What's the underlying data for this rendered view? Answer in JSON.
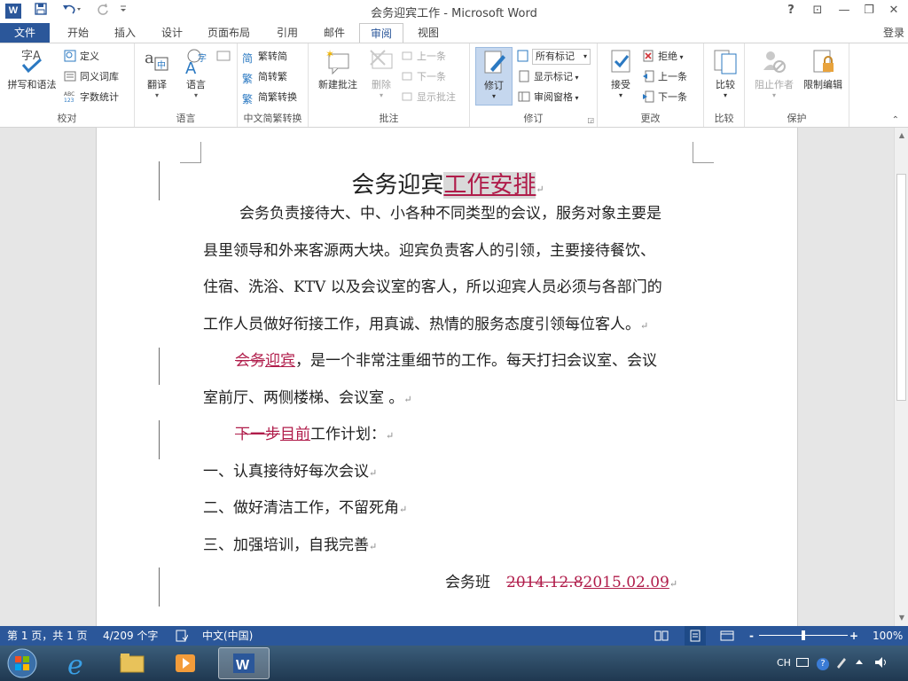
{
  "window": {
    "title": "会务迎宾工作 - Microsoft Word",
    "help": "?",
    "buttons": {
      "ribbon": "⊡",
      "minimize": "—",
      "restore": "❐",
      "close": "✕"
    }
  },
  "quick_access": {
    "logo": "W",
    "save_icon": "save-icon",
    "undo_icon": "undo-icon",
    "redo_icon": "redo-icon"
  },
  "tabs": [
    {
      "label": "文件"
    },
    {
      "label": "开始"
    },
    {
      "label": "插入"
    },
    {
      "label": "设计"
    },
    {
      "label": "页面布局"
    },
    {
      "label": "引用"
    },
    {
      "label": "邮件"
    },
    {
      "label": "审阅"
    },
    {
      "label": "视图"
    }
  ],
  "login": "登录",
  "ribbon": {
    "proofing": {
      "label": "校对",
      "spell": "拼写和语法",
      "define": "定义",
      "thesaurus": "同义词库",
      "wordcount": "字数统计"
    },
    "language": {
      "label": "语言",
      "translate": "翻译",
      "language": "语言"
    },
    "chinese": {
      "label": "中文简繁转换",
      "to_simplified": "繁转简",
      "to_traditional": "简转繁",
      "convert": "简繁转换"
    },
    "comments": {
      "label": "批注",
      "new": "新建批注",
      "delete": "删除",
      "prev": "上一条",
      "next": "下一条",
      "show": "显示批注"
    },
    "tracking": {
      "label": "修订",
      "track": "修订",
      "markup_select": "所有标记",
      "show_markup": "显示标记",
      "pane": "审阅窗格"
    },
    "changes": {
      "label": "更改",
      "accept": "接受",
      "reject": "拒绝",
      "prev": "上一条",
      "next": "下一条"
    },
    "compare": {
      "label": "比较",
      "compare": "比较"
    },
    "protect": {
      "label": "保护",
      "block": "阻止作者",
      "restrict": "限制编辑"
    }
  },
  "document": {
    "title_plain": "会务迎宾",
    "title_ins": "工作安排",
    "p1_lines": [
      "会务负责接待大、中、小各种不同类型的会议，服务对象主要是",
      "县里领导和外来客源两大块。迎宾负责客人的引领，主要接待餐饮、",
      "住宿、洗浴、KTV 以及会议室的客人，所以迎宾人员必须与各部门的",
      "工作人员做好衔接工作，用真诚、热情的服务态度引领每位客人。"
    ],
    "p2_del": "会务",
    "p2_ins": "迎宾",
    "p2_rest": "，是一个非常注重细节的工作。每天打扫会议室、会议",
    "p2_line2": "室前厅、两侧楼梯、会议室 。",
    "p3_del": "下一步",
    "p3_ins": "目前",
    "p3_rest": "工作计划：",
    "item1": "一、认真接待好每次会议",
    "item2": "二、做好清洁工作，不留死角",
    "item3": "三、加强培训，自我完善",
    "sign_name": "会务班",
    "sign_del": "2014.12.8",
    "sign_ins": "2015.02.09",
    "para_mark": "↵"
  },
  "status": {
    "page": "第 1 页，共 1 页",
    "words": "4/209 个字",
    "lang": "中文(中国)",
    "zoom": "100%",
    "zoom_minus": "-",
    "zoom_plus": "+"
  },
  "tray": {
    "lang": "CH",
    "help": "?"
  },
  "colors": {
    "accent": "#2b579a",
    "revision": "#b01c4a"
  }
}
